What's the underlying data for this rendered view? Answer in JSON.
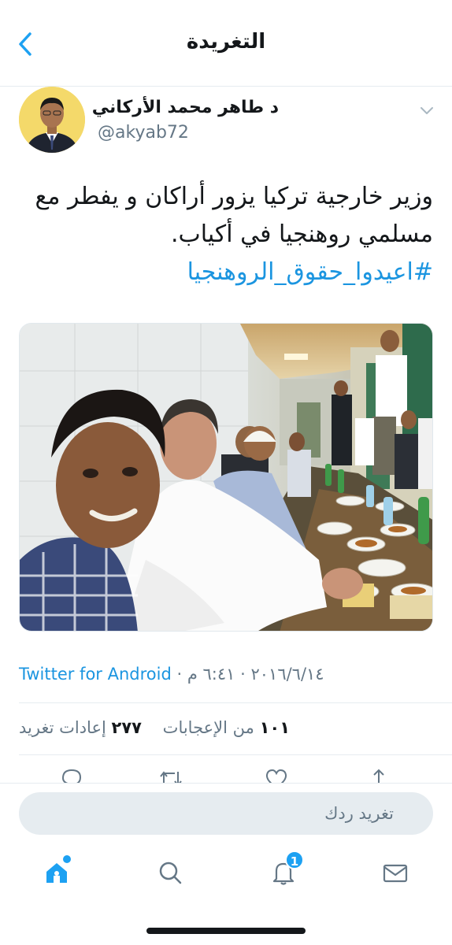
{
  "header": {
    "title": "التغريدة",
    "back_icon": "chevron-left-icon"
  },
  "author": {
    "name": "د طاهر محمد الأركاني",
    "handle": "@akyab72",
    "menu_icon": "chevron-down-icon"
  },
  "tweet": {
    "line1": "وزير خارجية تركيا يزور أراكان و يفطر مع",
    "line2": "مسلمي روهنجيا في أكياب.",
    "hashtag": "#اعيدوا_حقوق_الروهنجيا"
  },
  "meta": {
    "time": "٦:٤١ م",
    "separator": " · ",
    "date": "٢٠١٦/٦/١٤",
    "source": "Twitter for Android"
  },
  "stats": {
    "likes_count": "١٠١",
    "likes_label": "من الإعجابات",
    "retweets_count": "٢٧٧",
    "retweets_label": "إعادات تغريد"
  },
  "actions": [
    "reply-icon",
    "retweet-icon",
    "heart-icon",
    "share-icon"
  ],
  "reply": {
    "placeholder": "تغريد ردك"
  },
  "tabs": {
    "home_icon": "home-icon",
    "search_icon": "search-icon",
    "notifications_icon": "bell-icon",
    "notifications_badge": "1",
    "messages_icon": "mail-icon"
  },
  "colors": {
    "accent": "#1da1f2",
    "link": "#1b95e0",
    "secondary_text": "#657786",
    "divider": "#e6ecf0"
  }
}
